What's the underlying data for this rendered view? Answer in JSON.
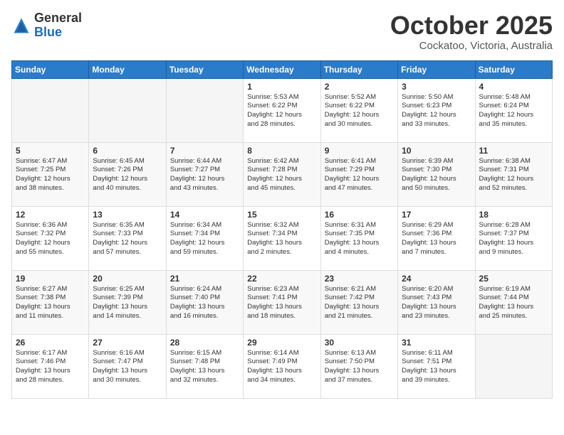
{
  "header": {
    "logo_general": "General",
    "logo_blue": "Blue",
    "month_title": "October 2025",
    "location": "Cockatoo, Victoria, Australia"
  },
  "weekdays": [
    "Sunday",
    "Monday",
    "Tuesday",
    "Wednesday",
    "Thursday",
    "Friday",
    "Saturday"
  ],
  "weeks": [
    [
      {
        "day": "",
        "info": ""
      },
      {
        "day": "",
        "info": ""
      },
      {
        "day": "",
        "info": ""
      },
      {
        "day": "1",
        "info": "Sunrise: 5:53 AM\nSunset: 6:22 PM\nDaylight: 12 hours\nand 28 minutes."
      },
      {
        "day": "2",
        "info": "Sunrise: 5:52 AM\nSunset: 6:22 PM\nDaylight: 12 hours\nand 30 minutes."
      },
      {
        "day": "3",
        "info": "Sunrise: 5:50 AM\nSunset: 6:23 PM\nDaylight: 12 hours\nand 33 minutes."
      },
      {
        "day": "4",
        "info": "Sunrise: 5:48 AM\nSunset: 6:24 PM\nDaylight: 12 hours\nand 35 minutes."
      }
    ],
    [
      {
        "day": "5",
        "info": "Sunrise: 6:47 AM\nSunset: 7:25 PM\nDaylight: 12 hours\nand 38 minutes."
      },
      {
        "day": "6",
        "info": "Sunrise: 6:45 AM\nSunset: 7:26 PM\nDaylight: 12 hours\nand 40 minutes."
      },
      {
        "day": "7",
        "info": "Sunrise: 6:44 AM\nSunset: 7:27 PM\nDaylight: 12 hours\nand 43 minutes."
      },
      {
        "day": "8",
        "info": "Sunrise: 6:42 AM\nSunset: 7:28 PM\nDaylight: 12 hours\nand 45 minutes."
      },
      {
        "day": "9",
        "info": "Sunrise: 6:41 AM\nSunset: 7:29 PM\nDaylight: 12 hours\nand 47 minutes."
      },
      {
        "day": "10",
        "info": "Sunrise: 6:39 AM\nSunset: 7:30 PM\nDaylight: 12 hours\nand 50 minutes."
      },
      {
        "day": "11",
        "info": "Sunrise: 6:38 AM\nSunset: 7:31 PM\nDaylight: 12 hours\nand 52 minutes."
      }
    ],
    [
      {
        "day": "12",
        "info": "Sunrise: 6:36 AM\nSunset: 7:32 PM\nDaylight: 12 hours\nand 55 minutes."
      },
      {
        "day": "13",
        "info": "Sunrise: 6:35 AM\nSunset: 7:33 PM\nDaylight: 12 hours\nand 57 minutes."
      },
      {
        "day": "14",
        "info": "Sunrise: 6:34 AM\nSunset: 7:34 PM\nDaylight: 12 hours\nand 59 minutes."
      },
      {
        "day": "15",
        "info": "Sunrise: 6:32 AM\nSunset: 7:34 PM\nDaylight: 13 hours\nand 2 minutes."
      },
      {
        "day": "16",
        "info": "Sunrise: 6:31 AM\nSunset: 7:35 PM\nDaylight: 13 hours\nand 4 minutes."
      },
      {
        "day": "17",
        "info": "Sunrise: 6:29 AM\nSunset: 7:36 PM\nDaylight: 13 hours\nand 7 minutes."
      },
      {
        "day": "18",
        "info": "Sunrise: 6:28 AM\nSunset: 7:37 PM\nDaylight: 13 hours\nand 9 minutes."
      }
    ],
    [
      {
        "day": "19",
        "info": "Sunrise: 6:27 AM\nSunset: 7:38 PM\nDaylight: 13 hours\nand 11 minutes."
      },
      {
        "day": "20",
        "info": "Sunrise: 6:25 AM\nSunset: 7:39 PM\nDaylight: 13 hours\nand 14 minutes."
      },
      {
        "day": "21",
        "info": "Sunrise: 6:24 AM\nSunset: 7:40 PM\nDaylight: 13 hours\nand 16 minutes."
      },
      {
        "day": "22",
        "info": "Sunrise: 6:23 AM\nSunset: 7:41 PM\nDaylight: 13 hours\nand 18 minutes."
      },
      {
        "day": "23",
        "info": "Sunrise: 6:21 AM\nSunset: 7:42 PM\nDaylight: 13 hours\nand 21 minutes."
      },
      {
        "day": "24",
        "info": "Sunrise: 6:20 AM\nSunset: 7:43 PM\nDaylight: 13 hours\nand 23 minutes."
      },
      {
        "day": "25",
        "info": "Sunrise: 6:19 AM\nSunset: 7:44 PM\nDaylight: 13 hours\nand 25 minutes."
      }
    ],
    [
      {
        "day": "26",
        "info": "Sunrise: 6:17 AM\nSunset: 7:46 PM\nDaylight: 13 hours\nand 28 minutes."
      },
      {
        "day": "27",
        "info": "Sunrise: 6:16 AM\nSunset: 7:47 PM\nDaylight: 13 hours\nand 30 minutes."
      },
      {
        "day": "28",
        "info": "Sunrise: 6:15 AM\nSunset: 7:48 PM\nDaylight: 13 hours\nand 32 minutes."
      },
      {
        "day": "29",
        "info": "Sunrise: 6:14 AM\nSunset: 7:49 PM\nDaylight: 13 hours\nand 34 minutes."
      },
      {
        "day": "30",
        "info": "Sunrise: 6:13 AM\nSunset: 7:50 PM\nDaylight: 13 hours\nand 37 minutes."
      },
      {
        "day": "31",
        "info": "Sunrise: 6:11 AM\nSunset: 7:51 PM\nDaylight: 13 hours\nand 39 minutes."
      },
      {
        "day": "",
        "info": ""
      }
    ]
  ]
}
